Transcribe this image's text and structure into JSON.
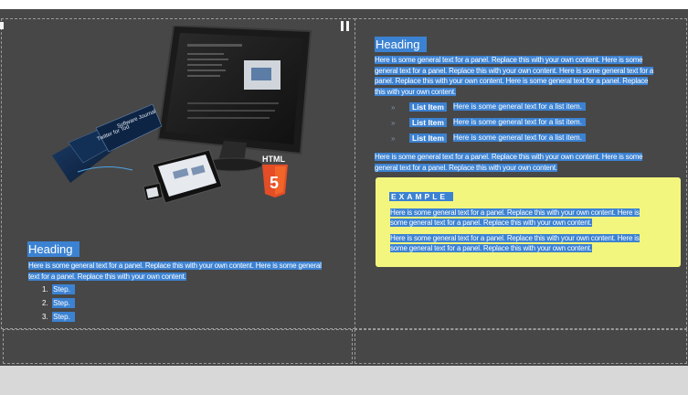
{
  "left_panel": {
    "heading": "Heading",
    "paragraph": "Here is some general text for a panel. Replace this with your own content. Here is some general text for a panel. Replace this with your own content.",
    "steps": [
      "Step.",
      "Step.",
      "Step."
    ],
    "image": {
      "badge_text": "HTML",
      "badge_number": "5",
      "book_titles": [
        "Twitter for Tod",
        "Software Journal"
      ]
    }
  },
  "right_panel": {
    "heading": "Heading",
    "paragraph_lines": [
      "Here is some general text for a panel. Replace this with your own content. Here is some",
      "general text for a panel. Replace this with your own content. Here is some general text for a",
      "panel. Replace this with your own content. Here is some general text for a panel. Replace",
      "this with your own content."
    ],
    "list_items": [
      {
        "chevron": "»",
        "label": "List Item",
        "text": "Here is some general text for a list item."
      },
      {
        "chevron": "»",
        "label": "List Item",
        "text": "Here is some general text for a list item."
      },
      {
        "chevron": "»",
        "label": "List Item",
        "text": "Here is some general text for a list item."
      }
    ],
    "paragraph2_lines": [
      "Here is some general text for a panel. Replace this with your own content. Here is some",
      "general text for a panel. Replace this with your own content."
    ],
    "example": {
      "label": "EXAMPLE",
      "para1_lines": [
        "Here is some general text for a panel. Replace this with your own content. Here is",
        "some general text for a panel. Replace this with your own content."
      ],
      "para2_lines": [
        "Here is some general text for a panel. Replace this with your own content. Here is",
        "some general text for a panel. Replace this with your own content."
      ]
    }
  },
  "colors": {
    "canvas": "#474747",
    "selection": "#3c82d2",
    "example_box": "#f3f67e"
  }
}
